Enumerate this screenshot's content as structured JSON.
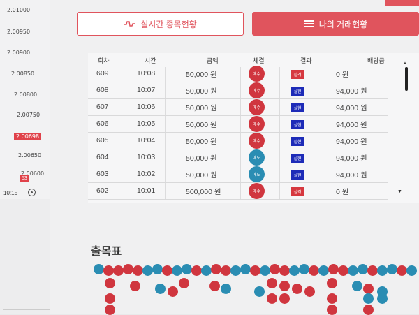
{
  "ticker": {
    "prices": [
      "2.01000",
      "2.00950",
      "2.00900",
      "2.00850",
      "2.00800",
      "2.00750",
      "2.00698",
      "2.00650",
      "2.00600"
    ],
    "highlight": "2.00698",
    "badge": "53",
    "time": "10:15"
  },
  "tabs": {
    "realtime": "실시간 종목현황",
    "mine": "나의 거래현황"
  },
  "table": {
    "headers": [
      "회차",
      "시간",
      "금액",
      "체결",
      "결과",
      "배당금"
    ],
    "rows": [
      {
        "round": "609",
        "time": "10:08",
        "amount": "50,000 원",
        "side": "매수",
        "side_type": "sell",
        "result": "실격",
        "result_type": "lose",
        "payout": "0 원"
      },
      {
        "round": "608",
        "time": "10:07",
        "amount": "50,000 원",
        "side": "매수",
        "side_type": "sell",
        "result": "실현",
        "result_type": "win",
        "payout": "94,000 원"
      },
      {
        "round": "607",
        "time": "10:06",
        "amount": "50,000 원",
        "side": "매수",
        "side_type": "sell",
        "result": "실현",
        "result_type": "win",
        "payout": "94,000 원"
      },
      {
        "round": "606",
        "time": "10:05",
        "amount": "50,000 원",
        "side": "매수",
        "side_type": "sell",
        "result": "실현",
        "result_type": "win",
        "payout": "94,000 원"
      },
      {
        "round": "605",
        "time": "10:04",
        "amount": "50,000 원",
        "side": "매수",
        "side_type": "sell",
        "result": "실현",
        "result_type": "win",
        "payout": "94,000 원"
      },
      {
        "round": "604",
        "time": "10:03",
        "amount": "50,000 원",
        "side": "매도",
        "side_type": "buy",
        "result": "실현",
        "result_type": "win",
        "payout": "94,000 원"
      },
      {
        "round": "603",
        "time": "10:02",
        "amount": "50,000 원",
        "side": "매도",
        "side_type": "buy",
        "result": "실현",
        "result_type": "win",
        "payout": "94,000 원"
      },
      {
        "round": "602",
        "time": "10:01",
        "amount": "500,000 원",
        "side": "매수",
        "side_type": "sell",
        "result": "실격",
        "result_type": "lose",
        "payout": "0 원"
      }
    ]
  },
  "bead_section": {
    "title": "출목표",
    "row1": [
      "b",
      "r",
      "r",
      "r",
      "r",
      "b",
      "b",
      "r",
      "b",
      "b",
      "r",
      "b",
      "r",
      "r",
      "b",
      "b",
      "r",
      "b",
      "r",
      "r",
      "b",
      "b",
      "r",
      "b",
      "r",
      "r",
      "b",
      "b",
      "r",
      "b",
      "b",
      "r",
      "b"
    ],
    "row2_colors": [
      "r",
      "r",
      "b",
      "r",
      "r",
      "r",
      "b",
      "b",
      "r",
      "r",
      "r",
      "r",
      "r",
      "b",
      "r",
      "b"
    ],
    "colors": {
      "red": "#d0363f",
      "blue": "#2a8db3",
      "accent": "#e0545d"
    }
  }
}
